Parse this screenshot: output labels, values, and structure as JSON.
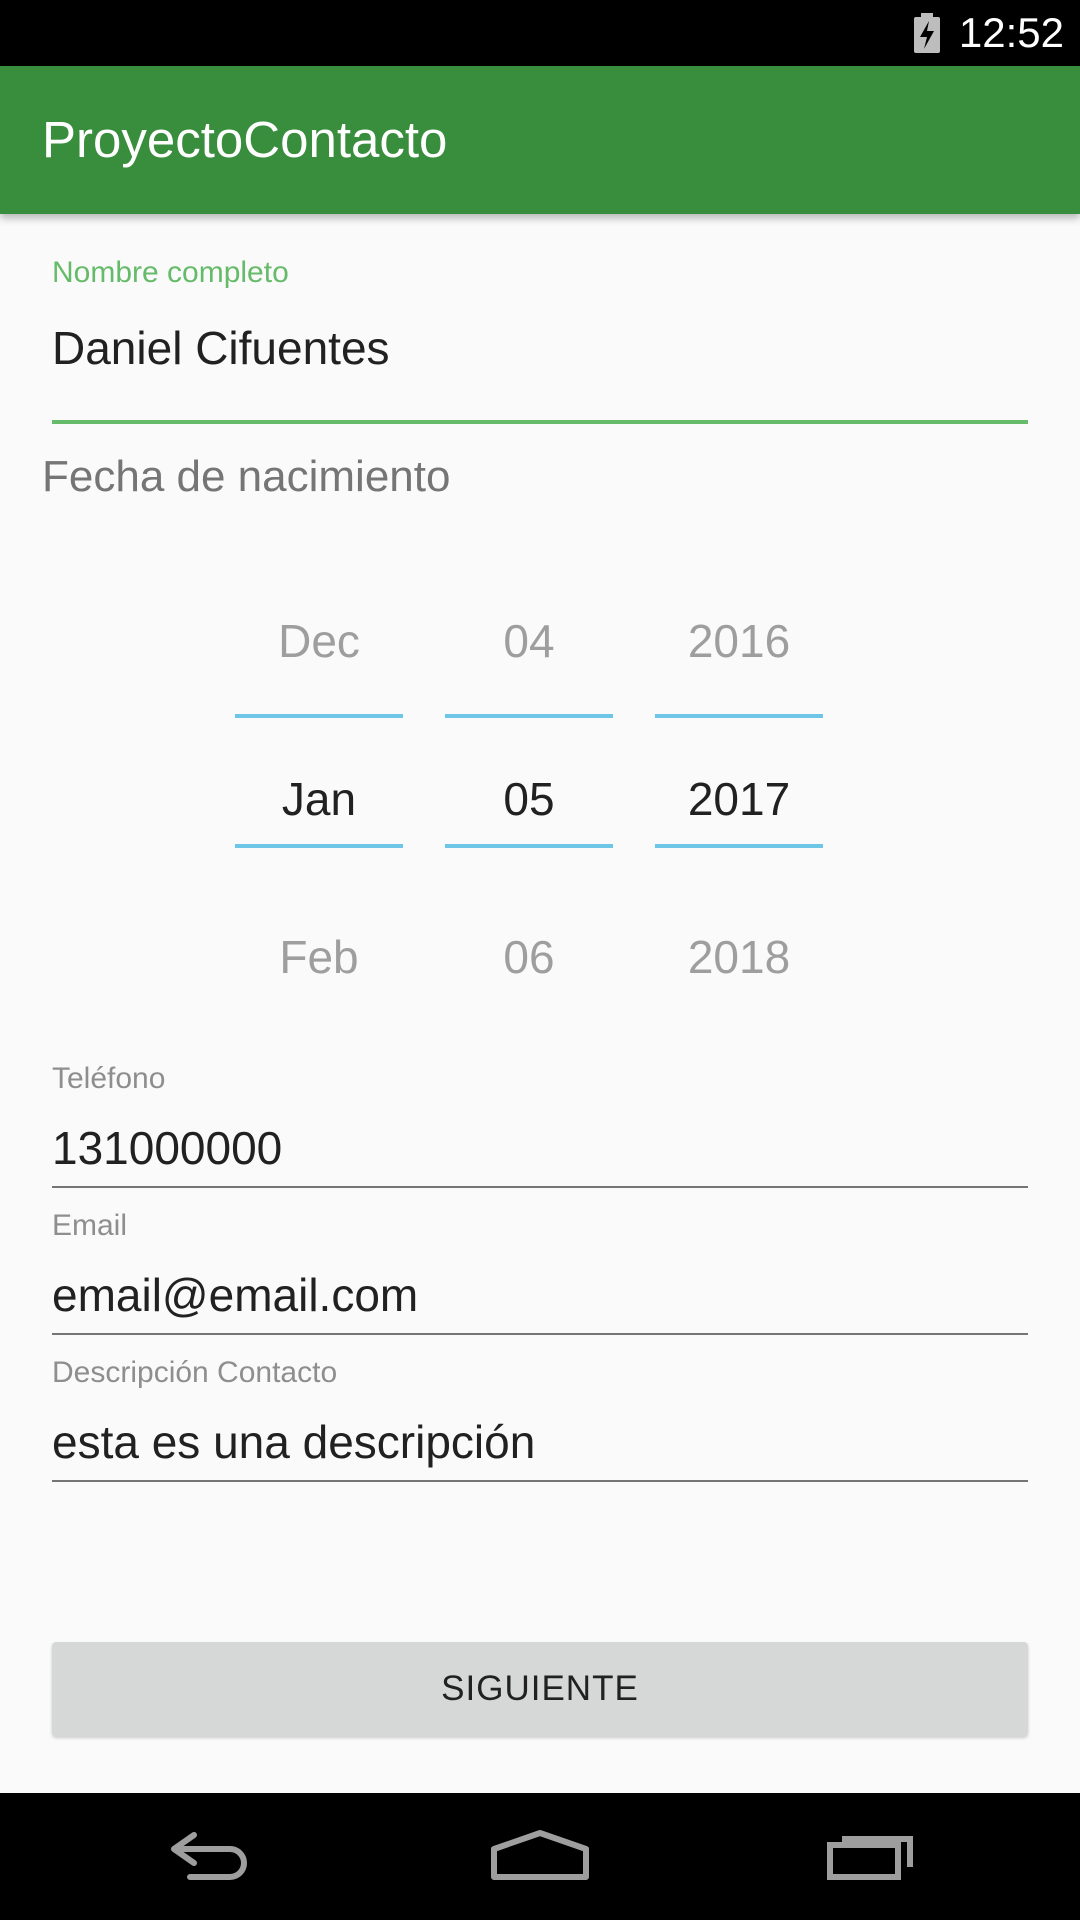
{
  "status_bar": {
    "time": "12:52",
    "icons": [
      "battery-charging-icon"
    ]
  },
  "app_bar": {
    "title": "ProyectoContacto",
    "color": "#388e3c"
  },
  "form": {
    "name": {
      "label": "Nombre completo",
      "value": "Daniel Cifuentes"
    },
    "birthdate": {
      "label": "Fecha de nacimiento",
      "month": {
        "prev": "Dec",
        "selected": "Jan",
        "next": "Feb"
      },
      "day": {
        "prev": "04",
        "selected": "05",
        "next": "06"
      },
      "year": {
        "prev": "2016",
        "selected": "2017",
        "next": "2018"
      }
    },
    "phone": {
      "label": "Teléfono",
      "value": "131000000"
    },
    "email": {
      "label": "Email",
      "value": "email@email.com"
    },
    "description": {
      "label": "Descripción Contacto",
      "value": "esta es una descripción"
    },
    "next_button": "SIGUIENTE"
  },
  "nav_bar": {
    "icons": [
      "back-icon",
      "home-icon",
      "recents-icon"
    ]
  },
  "colors": {
    "accent": "#66bb6a",
    "picker_divider": "#6ec6e6",
    "button_bg": "#d6d7d7"
  }
}
